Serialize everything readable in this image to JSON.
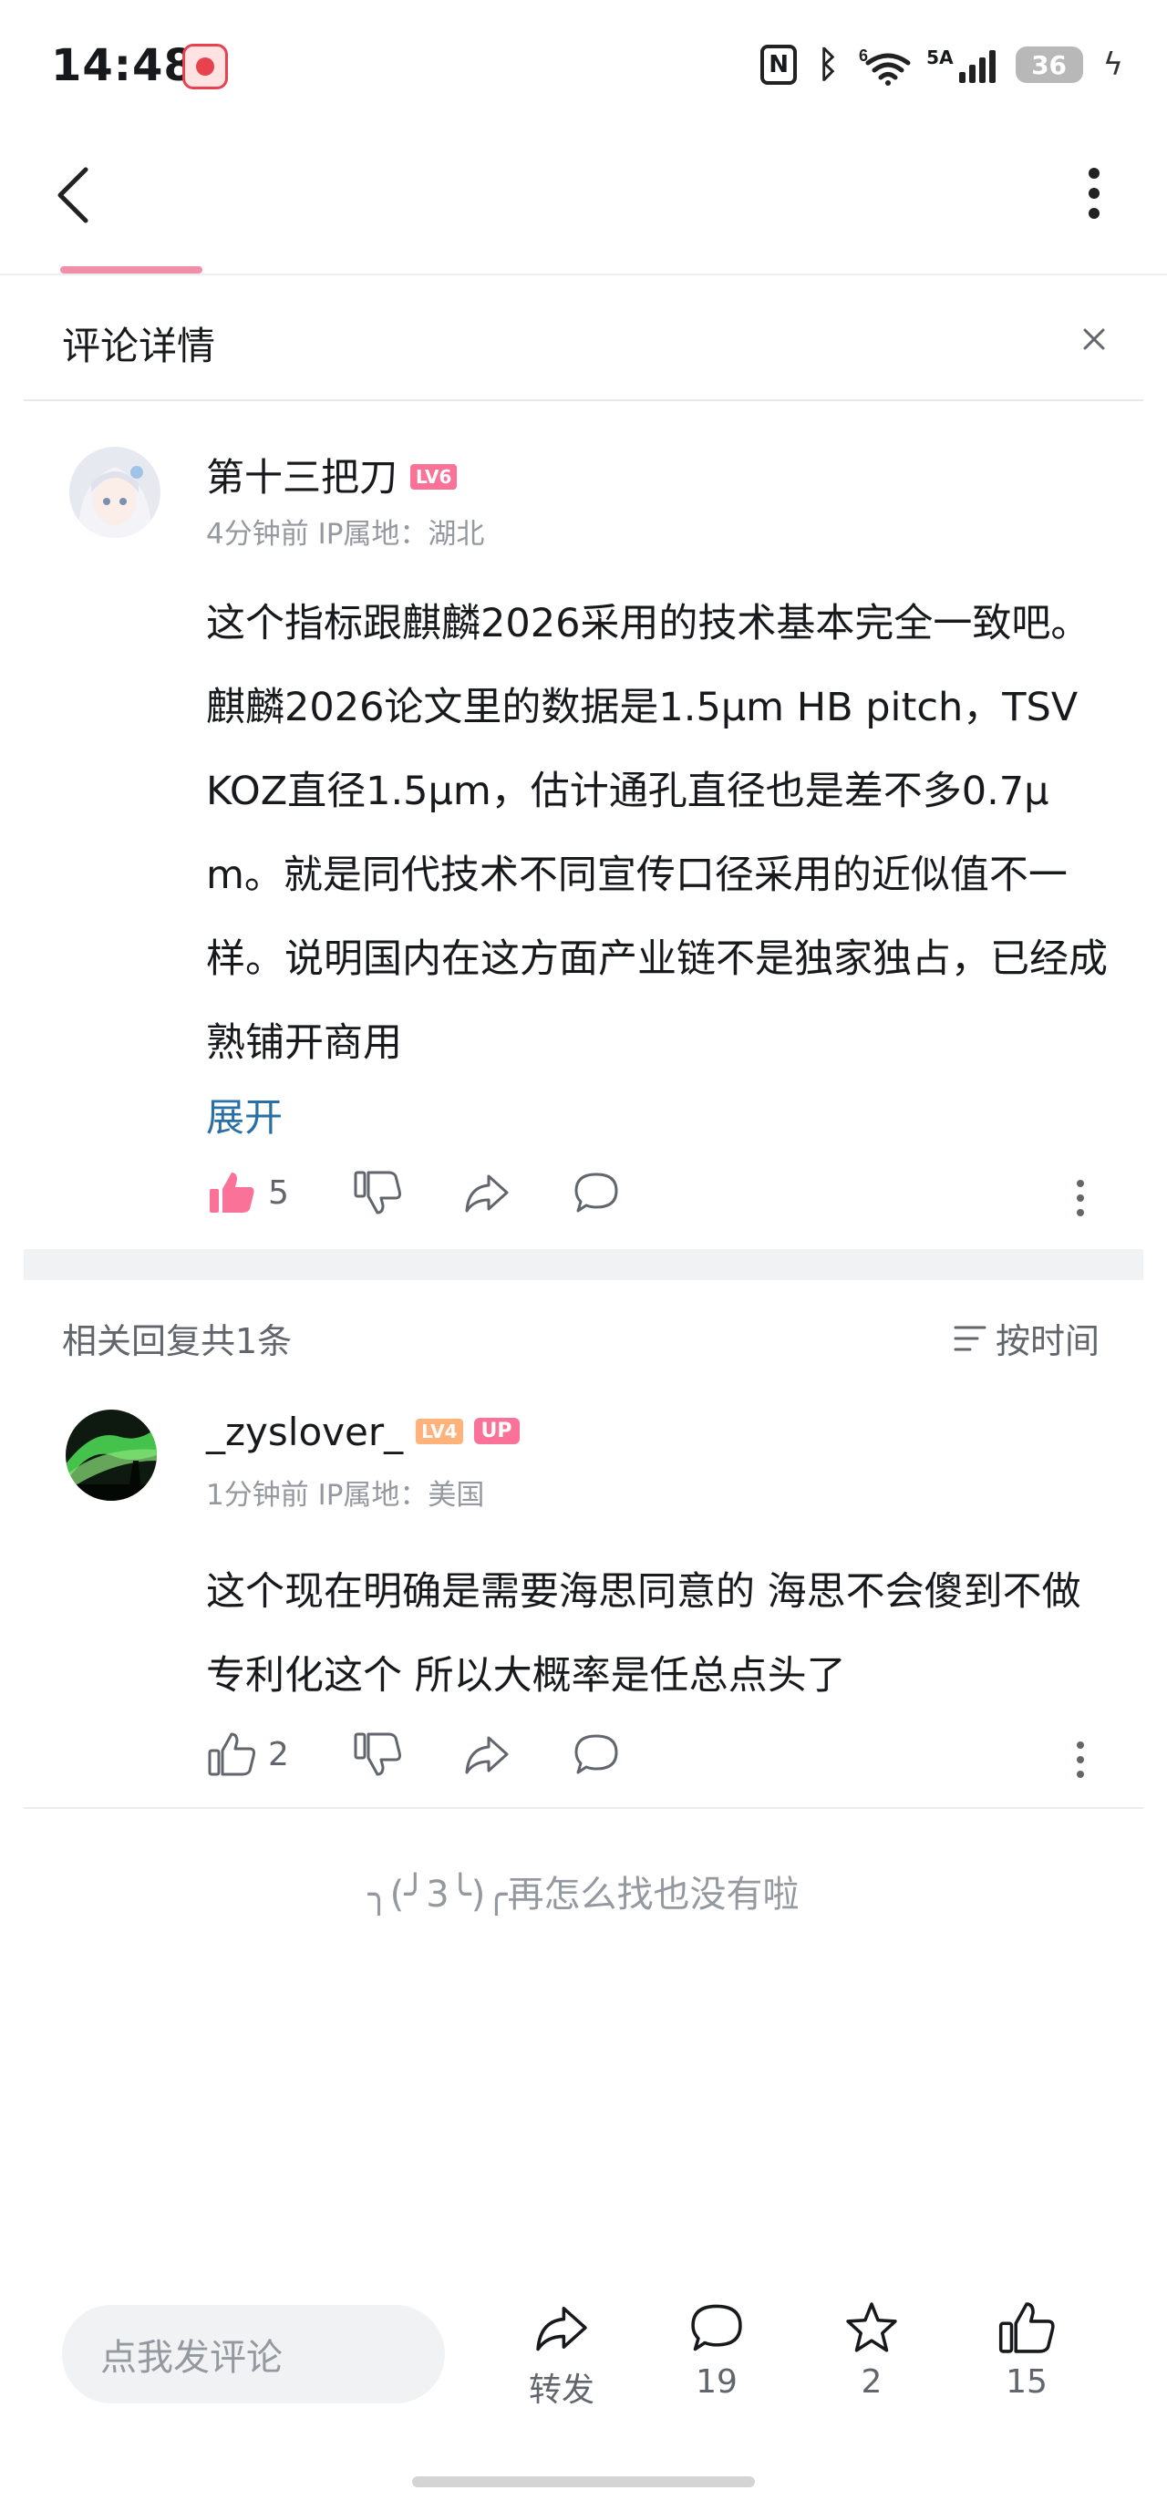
{
  "status_bar": {
    "time": "14:48",
    "signal_label_1": "6",
    "signal_label_2": "5A",
    "battery": "36",
    "nfc": "N"
  },
  "sheet": {
    "title": "评论详情"
  },
  "main_comment": {
    "username": "第十三把刀",
    "level": "LV6",
    "level_color": "#fb7299",
    "meta": "4分钟前 IP属地：湖北",
    "text": "这个指标跟麒麟2026采用的技术基本完全一致吧。麒麟2026论文里的数据是1.5μm HB pitch，TSV KOZ直径1.5μm，估计通孔直径也是差不多0.7μm。就是同代技术不同宣传口径采用的近似值不一样。说明国内在这方面产业链不是独家独占，已经成熟铺开商用",
    "expand": "展开",
    "likes": "5",
    "liked": true,
    "like_color": "#fb7299"
  },
  "replies": {
    "header": "相关回复共1条",
    "sort": "按时间",
    "items": [
      {
        "username": "_zyslover_",
        "level": "LV4",
        "level_color": "#ffb27a",
        "badge": "UP",
        "meta": "1分钟前 IP属地：美国",
        "text": "这个现在明确是需要海思同意的 海思不会傻到不做专利化这个 所以大概率是任总点头了",
        "likes": "2"
      }
    ]
  },
  "end_text": "╮(╯3╰)╭再怎么找也没有啦",
  "bottom_bar": {
    "input_placeholder": "点我发评论",
    "share_label": "转发",
    "comments_count": "19",
    "favorites_count": "2",
    "likes_count": "15"
  },
  "icons": [
    "back-icon",
    "more-icon",
    "close-icon",
    "thumbs-up-icon",
    "thumbs-down-icon",
    "share-icon",
    "comment-icon",
    "star-icon",
    "sort-icon"
  ]
}
